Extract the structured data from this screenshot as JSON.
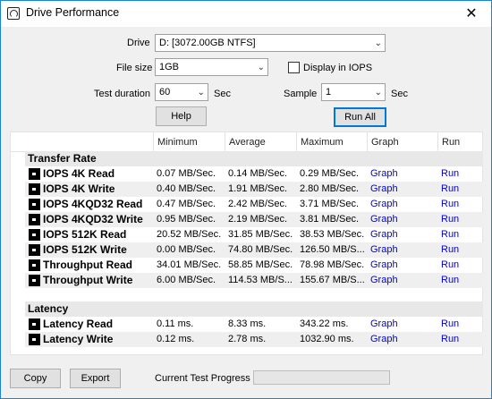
{
  "window": {
    "title": "Drive Performance",
    "close_glyph": "✕"
  },
  "form": {
    "drive_label": "Drive",
    "drive_value": "D: [3072.00GB NTFS]",
    "filesize_label": "File size",
    "filesize_value": "1GB",
    "iops_checkbox_label": "Display in IOPS",
    "iops_checked": false,
    "duration_label": "Test duration",
    "duration_value": "60",
    "duration_unit": "Sec",
    "sample_label": "Sample",
    "sample_value": "1",
    "sample_unit": "Sec",
    "help_label": "Help",
    "run_all_label": "Run All"
  },
  "table": {
    "headers": [
      "Minimum",
      "Average",
      "Maximum",
      "Graph",
      "Run"
    ],
    "sections": [
      {
        "title": "Transfer Rate",
        "rows": [
          {
            "name": "IOPS 4K Read",
            "min": "0.07 MB/Sec.",
            "avg": "0.14 MB/Sec.",
            "max": "0.29 MB/Sec.",
            "graph": "Graph",
            "run": "Run"
          },
          {
            "name": "IOPS 4K Write",
            "min": "0.40 MB/Sec.",
            "avg": "1.91 MB/Sec.",
            "max": "2.80 MB/Sec.",
            "graph": "Graph",
            "run": "Run"
          },
          {
            "name": "IOPS 4KQD32 Read",
            "min": "0.47 MB/Sec.",
            "avg": "2.42 MB/Sec.",
            "max": "3.71 MB/Sec.",
            "graph": "Graph",
            "run": "Run"
          },
          {
            "name": "IOPS 4KQD32 Write",
            "min": "0.95 MB/Sec.",
            "avg": "2.19 MB/Sec.",
            "max": "3.81 MB/Sec.",
            "graph": "Graph",
            "run": "Run"
          },
          {
            "name": "IOPS 512K Read",
            "min": "20.52 MB/Sec.",
            "avg": "31.85 MB/Sec.",
            "max": "38.53 MB/Sec.",
            "graph": "Graph",
            "run": "Run"
          },
          {
            "name": "IOPS 512K Write",
            "min": "0.00 MB/Sec.",
            "avg": "74.80 MB/Sec.",
            "max": "126.50 MB/S...",
            "graph": "Graph",
            "run": "Run"
          },
          {
            "name": "Throughput Read",
            "min": "34.01 MB/Sec.",
            "avg": "58.85 MB/Sec.",
            "max": "78.98 MB/Sec.",
            "graph": "Graph",
            "run": "Run"
          },
          {
            "name": "Throughput Write",
            "min": "6.00 MB/Sec.",
            "avg": "114.53 MB/S...",
            "max": "155.67 MB/S...",
            "graph": "Graph",
            "run": "Run"
          }
        ]
      },
      {
        "title": "Latency",
        "rows": [
          {
            "name": "Latency Read",
            "min": "0.11 ms.",
            "avg": "8.33 ms.",
            "max": "343.22 ms.",
            "graph": "Graph",
            "run": "Run"
          },
          {
            "name": "Latency Write",
            "min": "0.12 ms.",
            "avg": "2.78 ms.",
            "max": "1032.90 ms.",
            "graph": "Graph",
            "run": "Run"
          }
        ]
      }
    ]
  },
  "footer": {
    "copy_label": "Copy",
    "export_label": "Export",
    "progress_label": "Current Test Progress",
    "progress_value": 0
  },
  "colors": {
    "link": "#0000e0",
    "accent": "#0078d7",
    "progress": "#06b025"
  }
}
